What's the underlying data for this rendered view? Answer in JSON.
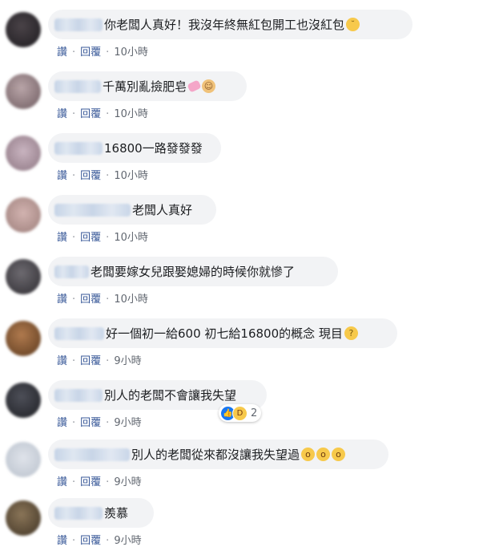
{
  "actions": {
    "like": "讚",
    "reply": "回覆"
  },
  "comments": [
    {
      "text": "你老闆人真好！我沒年終無紅包開工也沒紅包",
      "emoji": "pensive-face-icon",
      "time": "10小時"
    },
    {
      "text": "千萬別亂撿肥皂",
      "emoji": "soap-and-facepalm-icon",
      "time": "10小時"
    },
    {
      "text": "16800一路發發發",
      "time": "10小時"
    },
    {
      "text": "老闆人真好",
      "time": "10小時"
    },
    {
      "text": "老闆要嫁女兒跟娶媳婦的時候你就慘了",
      "time": "10小時"
    },
    {
      "text": "好一個初一給600 初七給16800的概念 現目",
      "emoji": "thinking-face-icon",
      "time": "9小時"
    },
    {
      "text": "別人的老闆不會讓我失望",
      "time": "9小時",
      "reactions": {
        "count": "2",
        "icons": [
          "like-icon",
          "haha-icon"
        ]
      }
    },
    {
      "text": "別人的老闆從來都沒讓我失望過",
      "emoji": "pleading-face-icon x3",
      "time": "9小時"
    },
    {
      "text": "羨慕",
      "time": "9小時"
    }
  ],
  "colors": {
    "bubble": "#f2f3f5",
    "link": "#385898",
    "like_blue": "#1877f2",
    "haha_yellow": "#f7c94b"
  }
}
